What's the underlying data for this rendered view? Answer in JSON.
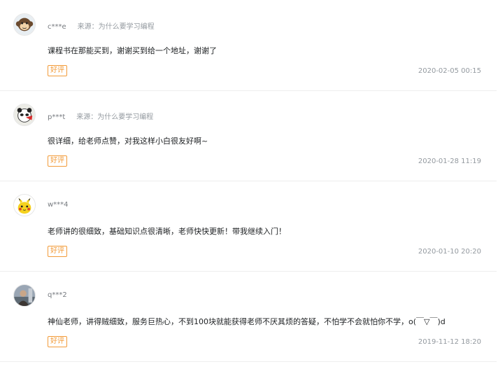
{
  "reviews": [
    {
      "user": "c***e",
      "source": "来源：为什么要学习编程",
      "content": "课程书在那能买到，谢谢买到给一个地址，谢谢了",
      "tag": "好评",
      "time": "2020-02-05 00:15",
      "avatar": "monkey-avatar-icon"
    },
    {
      "user": "p***t",
      "source": "来源：为什么要学习编程",
      "content": "很详细，给老师点赞，对我这样小白很友好啊~",
      "tag": "好评",
      "time": "2020-01-28 11:19",
      "avatar": "panda-avatar-icon"
    },
    {
      "user": "w***4",
      "source": "",
      "content": "老师讲的很细致，基础知识点很清晰，老师快快更新！带我继续入门！",
      "tag": "好评",
      "time": "2020-01-10 20:20",
      "avatar": "pikachu-avatar-icon"
    },
    {
      "user": "q***2",
      "source": "",
      "content": "神仙老师，讲得贼细致，服务巨热心，不到100块就能获得老师不厌其烦的答疑，不怕学不会就怕你不学，o(￣▽￣)d",
      "tag": "好评",
      "time": "2019-11-12 18:20",
      "avatar": "photo-avatar-icon"
    }
  ],
  "colors": {
    "tag": "#f29b39",
    "meta": "#93999f",
    "text": "#1c1f21",
    "divider": "#eeeeee"
  }
}
